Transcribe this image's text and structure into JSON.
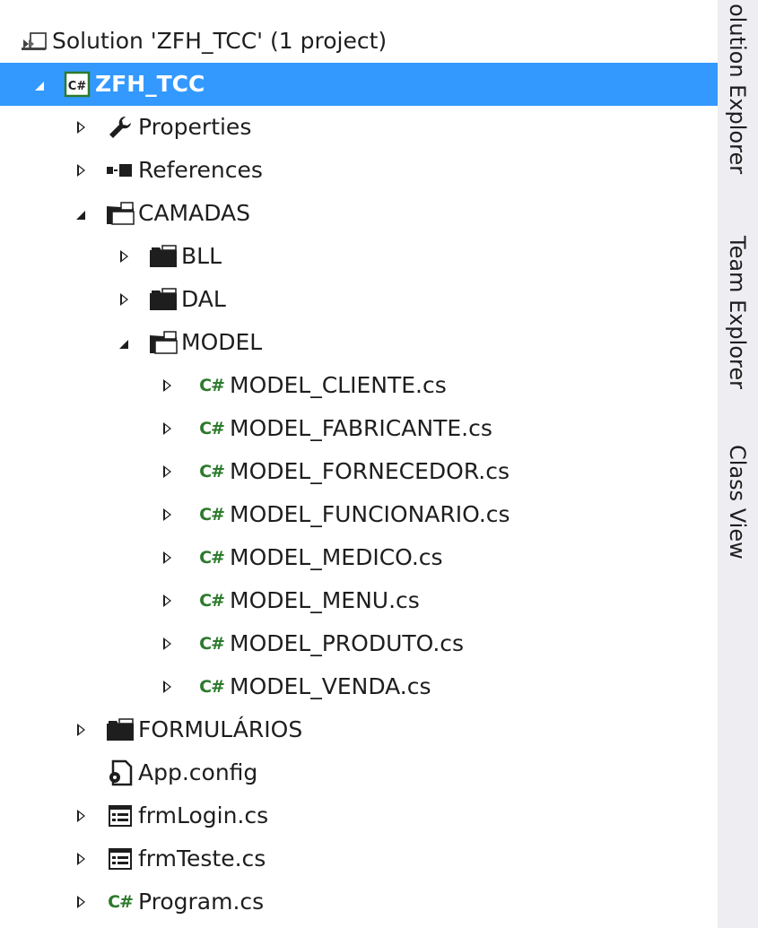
{
  "solution_explorer": {
    "items": [
      {
        "label": "Solution 'ZFH_TCC' (1 project)",
        "icon": "solution-icon",
        "expander": "none",
        "level": 0,
        "selected": false
      },
      {
        "label": "ZFH_TCC",
        "icon": "csharp-project-icon",
        "expander": "expanded",
        "level": 1,
        "selected": true
      },
      {
        "label": "Properties",
        "icon": "wrench-icon",
        "expander": "collapsed",
        "level": 2,
        "selected": false
      },
      {
        "label": "References",
        "icon": "references-icon",
        "expander": "collapsed",
        "level": 2,
        "selected": false
      },
      {
        "label": "CAMADAS",
        "icon": "folder-open-icon",
        "expander": "expanded",
        "level": 2,
        "selected": false
      },
      {
        "label": "BLL",
        "icon": "folder-icon",
        "expander": "collapsed",
        "level": 3,
        "selected": false
      },
      {
        "label": "DAL",
        "icon": "folder-icon",
        "expander": "collapsed",
        "level": 3,
        "selected": false
      },
      {
        "label": "MODEL",
        "icon": "folder-open-icon",
        "expander": "expanded",
        "level": 3,
        "selected": false
      },
      {
        "label": "MODEL_CLIENTE.cs",
        "icon": "csharp-file-icon",
        "expander": "collapsed",
        "level": 4,
        "selected": false
      },
      {
        "label": "MODEL_FABRICANTE.cs",
        "icon": "csharp-file-icon",
        "expander": "collapsed",
        "level": 4,
        "selected": false
      },
      {
        "label": "MODEL_FORNECEDOR.cs",
        "icon": "csharp-file-icon",
        "expander": "collapsed",
        "level": 4,
        "selected": false
      },
      {
        "label": "MODEL_FUNCIONARIO.cs",
        "icon": "csharp-file-icon",
        "expander": "collapsed",
        "level": 4,
        "selected": false
      },
      {
        "label": "MODEL_MEDICO.cs",
        "icon": "csharp-file-icon",
        "expander": "collapsed",
        "level": 4,
        "selected": false
      },
      {
        "label": "MODEL_MENU.cs",
        "icon": "csharp-file-icon",
        "expander": "collapsed",
        "level": 4,
        "selected": false
      },
      {
        "label": "MODEL_PRODUTO.cs",
        "icon": "csharp-file-icon",
        "expander": "collapsed",
        "level": 4,
        "selected": false
      },
      {
        "label": "MODEL_VENDA.cs",
        "icon": "csharp-file-icon",
        "expander": "collapsed",
        "level": 4,
        "selected": false
      },
      {
        "label": "FORMULÁRIOS",
        "icon": "folder-icon",
        "expander": "collapsed",
        "level": 2,
        "selected": false
      },
      {
        "label": "App.config",
        "icon": "config-file-icon",
        "expander": "none",
        "level": 2,
        "selected": false
      },
      {
        "label": "frmLogin.cs",
        "icon": "form-icon",
        "expander": "collapsed",
        "level": 2,
        "selected": false
      },
      {
        "label": "frmTeste.cs",
        "icon": "form-icon",
        "expander": "collapsed",
        "level": 2,
        "selected": false
      },
      {
        "label": "Program.cs",
        "icon": "csharp-file-icon",
        "expander": "collapsed",
        "level": 2,
        "selected": false
      }
    ]
  },
  "side_tabs": [
    {
      "label": "olution Explorer"
    },
    {
      "label": "Team Explorer"
    },
    {
      "label": "Class View"
    }
  ],
  "colors": {
    "selection": "#3399ff",
    "csharp_green": "#2c7a2c",
    "side_panel": "#eeeef2"
  }
}
